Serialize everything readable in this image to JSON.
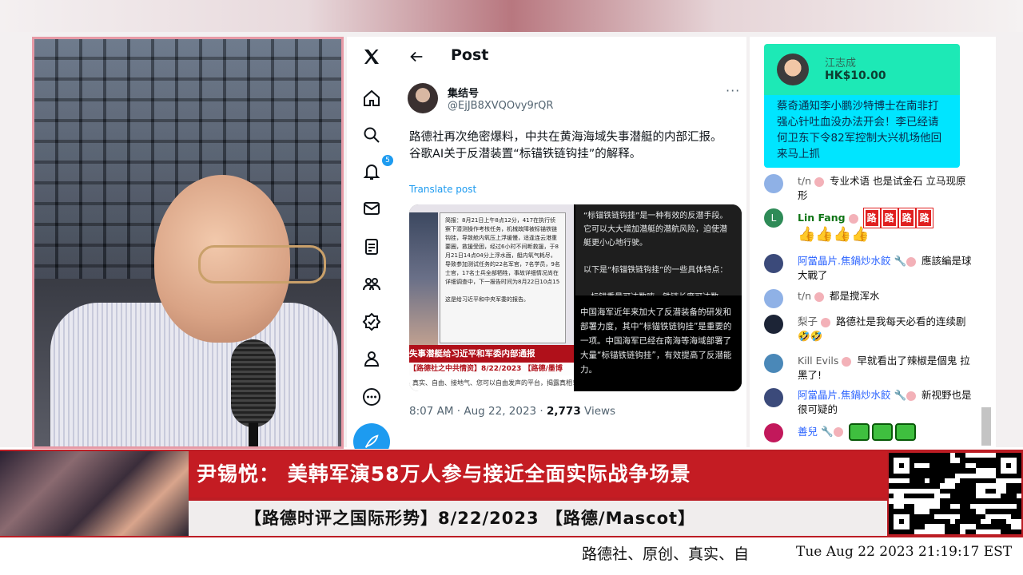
{
  "colors": {
    "accent": "#1d9bf0",
    "lower_third_red": "#c41c23",
    "superchat_top": "#1de9b6",
    "superchat_body": "#00e5ff"
  },
  "twitter": {
    "nav_icons": [
      "x-logo-icon",
      "home-icon",
      "search-icon",
      "bell-icon",
      "mail-icon",
      "list-icon",
      "communities-icon",
      "verified-icon",
      "profile-icon",
      "more-icon"
    ],
    "notification_count": "5",
    "header_title": "Post",
    "author_name": "集结号",
    "author_handle": "@EjJB8XVQOvy9rQR",
    "tweet_text": "路德社再次绝密爆料，中共在黄海海域失事潜艇的内部汇报。\n谷歌AI关于反潜装置“标锚铁链钩挂”的解释。",
    "translate_label": "Translate post",
    "media": {
      "doc_text": "简报：8月21日上午8点12分，417在执行侦察下潜测操作考核任务，机械故障被标锚铁链钩挂，导致舱内氧压上浮缓慢，适逢连云港重要圈，救援受困，经过6小时不间断救援，于8月21日14点04分上浮水面，艇内氧气耗尽，导致参加测试任务的22名军官，7名学员，9名士官，17名士兵全部牺牲，事故详细情况尚在详细调查中，下一报告时间为8月22日10点15\n\n这是给习近平和中央军委的报告。",
      "red_banner": "失事潜艇给习近平和军委内部通报",
      "sub_banner": "【路德社之中共情资】8/22/2023 【路德/墨博",
      "footer_line": "真实、自由、接地气、您可以自由发声的平台，揭露真相！",
      "ai_text_top": "“标锚铁链钩挂”是一种有效的反潜手段。它可以大大增加潜艇的潜航风险，迫使潜艇更小心地行驶。\n\n以下是“标锚铁链钩挂”的一些具体特点：\n\n• 标锚重量可达数吨，铁链长度可达数",
      "ai_text_bottom": "中国海军近年来加大了反潜装备的研发和部署力度，其中“标锚铁链钩挂”是重要的一项。中国海军已经在南海等海域部署了大量“标锚铁链钩挂”，有效提高了反潜能力。"
    },
    "time": "8:07 AM · Aug 22, 2023 · ",
    "views_count": "2,773",
    "views_label": " Views"
  },
  "chat": {
    "superchat": {
      "name": "江志成",
      "amount": "HK$10.00",
      "message": "蔡奇通知李小鹏沙特博士在南非打强心针吐血没办法开会！李已经请何卫东下令82军控制大兴机场他回来马上抓"
    },
    "messages": [
      {
        "name": "t/n",
        "text": "专业术语 也是试金石 立马现原形"
      },
      {
        "name": "Lin Fang",
        "road": [
          "路",
          "路",
          "路",
          "路"
        ],
        "emoji": "👍👍👍👍",
        "avatar_letter": "L"
      },
      {
        "name": "阿當晶片.焦鍋炒水餃",
        "text": "應該編是球大戰了"
      },
      {
        "name": "t/n",
        "text": "都是搅浑水"
      },
      {
        "name": "梨子",
        "text": "路德社是我每天必看的连续剧 🤣🤣"
      },
      {
        "name": "Kill Evils",
        "text": "早就看出了辣椒是個鬼 拉黑了!"
      },
      {
        "name": "阿當晶片.焦鍋炒水餃",
        "text": "新视野也是很可疑的"
      },
      {
        "name": "善兒",
        "text": ""
      }
    ]
  },
  "lower_third": {
    "title": "尹锡悦：  美韩军演58万人参与接近全面实际战争场景",
    "subtitle": "【路德时评之国际形势】8/22/2023 【路德/Mascot】"
  },
  "ticker": "路德社、原创、真实、自",
  "clock": "Tue Aug 22 2023 21:19:17 EST"
}
